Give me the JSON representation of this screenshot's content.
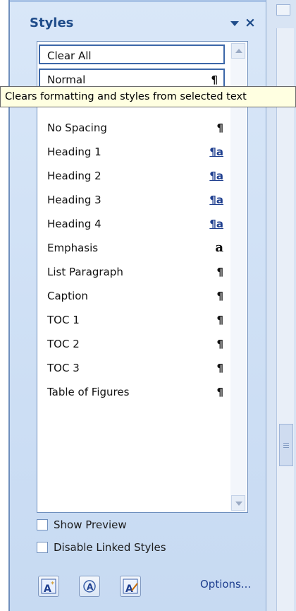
{
  "pane": {
    "title": "Styles",
    "menu_icon": "dropdown-arrow-icon",
    "close_icon": "close-x-icon",
    "close_label": "×"
  },
  "styles_list": [
    {
      "label": "Clear All",
      "mark": "",
      "boxed": true
    },
    {
      "label": "Normal",
      "mark": "¶",
      "boxed": true
    },
    {
      "label": "No Spacing",
      "mark": "¶"
    },
    {
      "label": "Heading 1",
      "mark": "¶a",
      "linked": true
    },
    {
      "label": "Heading 2",
      "mark": "¶a",
      "linked": true
    },
    {
      "label": "Heading 3",
      "mark": "¶a",
      "linked": true
    },
    {
      "label": "Heading 4",
      "mark": "¶a",
      "linked": true
    },
    {
      "label": "Emphasis",
      "mark": "a",
      "char": true
    },
    {
      "label": "List Paragraph",
      "mark": "¶"
    },
    {
      "label": "Caption",
      "mark": "¶"
    },
    {
      "label": "TOC 1",
      "mark": "¶"
    },
    {
      "label": "TOC 2",
      "mark": "¶"
    },
    {
      "label": "TOC 3",
      "mark": "¶"
    },
    {
      "label": "Table of Figures",
      "mark": "¶"
    }
  ],
  "tooltip": "Clears formatting and styles from selected text",
  "options": {
    "show_preview": "Show Preview",
    "disable_linked": "Disable Linked Styles"
  },
  "footer": {
    "new_style_icon": "new-style-icon",
    "style_inspector_icon": "style-inspector-icon",
    "manage_styles_icon": "manage-styles-icon",
    "options_link": "Options..."
  }
}
